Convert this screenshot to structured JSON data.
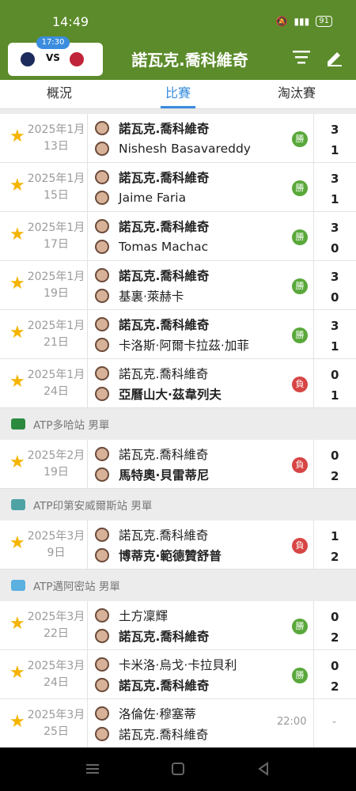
{
  "status": {
    "time": "14:49",
    "battery": "91",
    "network": "4G"
  },
  "header": {
    "title": "諾瓦克.喬科維奇",
    "chip_time": "17:30",
    "chip_vs": "VS"
  },
  "tabs": [
    {
      "label": "概況",
      "active": false
    },
    {
      "label": "比賽",
      "active": true
    },
    {
      "label": "淘汰賽",
      "active": false
    }
  ],
  "matches_group1": [
    {
      "date1": "2025年1月",
      "date2": "13日",
      "p1": "諾瓦克.喬科維奇",
      "p2": "Nishesh Basavareddy",
      "p1_bold": true,
      "p2_bold": false,
      "result": "勝",
      "s1": "3",
      "s2": "1"
    },
    {
      "date1": "2025年1月",
      "date2": "15日",
      "p1": "諾瓦克.喬科維奇",
      "p2": "Jaime Faria",
      "p1_bold": true,
      "p2_bold": false,
      "result": "勝",
      "s1": "3",
      "s2": "1"
    },
    {
      "date1": "2025年1月",
      "date2": "17日",
      "p1": "諾瓦克.喬科維奇",
      "p2": "Tomas Machac",
      "p1_bold": true,
      "p2_bold": false,
      "result": "勝",
      "s1": "3",
      "s2": "0"
    },
    {
      "date1": "2025年1月",
      "date2": "19日",
      "p1": "諾瓦克.喬科維奇",
      "p2": "基裏·萊赫卡",
      "p1_bold": true,
      "p2_bold": false,
      "result": "勝",
      "s1": "3",
      "s2": "0"
    },
    {
      "date1": "2025年1月",
      "date2": "21日",
      "p1": "諾瓦克.喬科維奇",
      "p2": "卡洛斯·阿爾卡拉茲·加菲",
      "p1_bold": true,
      "p2_bold": false,
      "result": "勝",
      "s1": "3",
      "s2": "1"
    },
    {
      "date1": "2025年1月",
      "date2": "24日",
      "p1": "諾瓦克.喬科維奇",
      "p2": "亞曆山大·茲韋列夫",
      "p1_bold": false,
      "p2_bold": true,
      "result": "負",
      "s1": "0",
      "s2": "1"
    }
  ],
  "section_doha": "ATP多哈站 男單",
  "match_doha": {
    "date1": "2025年2月",
    "date2": "19日",
    "p1": "諾瓦克.喬科維奇",
    "p2": "馬特奧·貝雷蒂尼",
    "result": "負",
    "s1": "0",
    "s2": "2"
  },
  "section_iw": "ATP印第安威爾斯站 男單",
  "match_iw": {
    "date1": "2025年3月",
    "date2": "9日",
    "p1": "諾瓦克.喬科維奇",
    "p2": "博蒂克·範德贊舒普",
    "result": "負",
    "s1": "1",
    "s2": "2"
  },
  "section_miami": "ATP邁阿密站 男單",
  "matches_miami": [
    {
      "date1": "2025年3月",
      "date2": "22日",
      "p1": "土方凜輝",
      "p2": "諾瓦克.喬科維奇",
      "result": "勝",
      "s1": "0",
      "s2": "2"
    },
    {
      "date1": "2025年3月",
      "date2": "24日",
      "p1": "卡米洛·烏戈·卡拉貝利",
      "p2": "諾瓦克.喬科維奇",
      "result": "勝",
      "s1": "0",
      "s2": "2"
    }
  ],
  "match_upcoming": {
    "date1": "2025年3月",
    "date2": "25日",
    "p1": "洛倫佐·穆塞蒂",
    "p2": "諾瓦克.喬科維奇",
    "time": "22:00",
    "score": "-"
  },
  "colors": {
    "header_green": "#5b8b2a",
    "accent_blue": "#3a8dde",
    "win": "#59a83a",
    "loss": "#d74545",
    "star": "#f5b400"
  }
}
